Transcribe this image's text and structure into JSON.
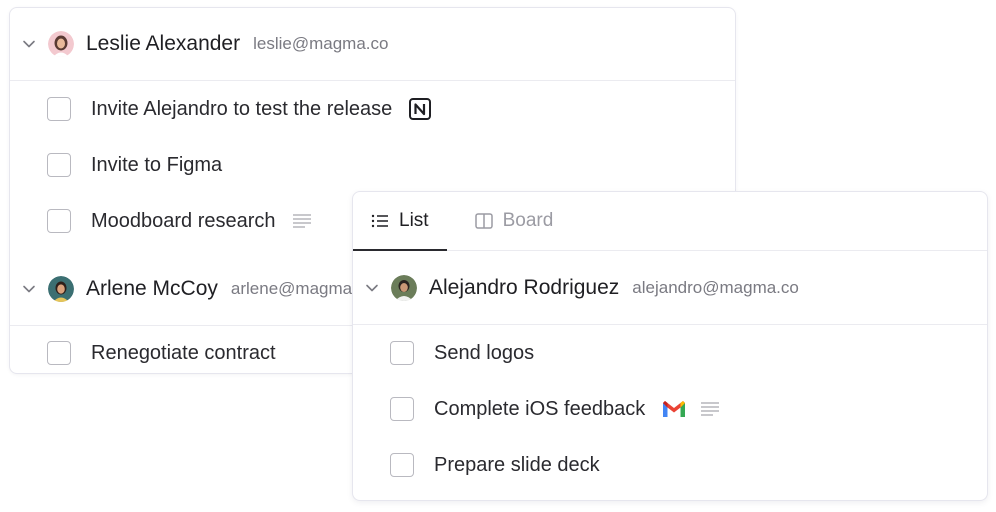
{
  "back_card": {
    "groups": [
      {
        "name": "Leslie Alexander",
        "email": "leslie@magma.co",
        "tasks": [
          {
            "label": "Invite Alejandro to test the release",
            "icon": "notion-icon"
          },
          {
            "label": "Invite to Figma",
            "icon": ""
          },
          {
            "label": "Moodboard research",
            "icon": "description-lines-icon"
          }
        ]
      },
      {
        "name": "Arlene McCoy",
        "email": "arlene@magma.co",
        "tasks": [
          {
            "label": "Renegotiate contract",
            "icon": ""
          }
        ]
      }
    ]
  },
  "front_card": {
    "tabs": [
      {
        "label": "List",
        "icon": "list-icon",
        "active": true
      },
      {
        "label": "Board",
        "icon": "board-icon",
        "active": false
      }
    ],
    "group": {
      "name": "Alejandro Rodriguez",
      "email": "alejandro@magma.co",
      "tasks": [
        {
          "label": "Send logos",
          "icon": ""
        },
        {
          "label": "Complete iOS feedback",
          "icons": [
            "gmail-icon",
            "description-lines-icon"
          ]
        },
        {
          "label": "Prepare slide deck",
          "icon": ""
        }
      ]
    }
  },
  "colors": {
    "text": "#1f1f23",
    "muted": "#7a7a82",
    "border": "#ebebf0",
    "checkbox_border": "#b9b9c0"
  }
}
